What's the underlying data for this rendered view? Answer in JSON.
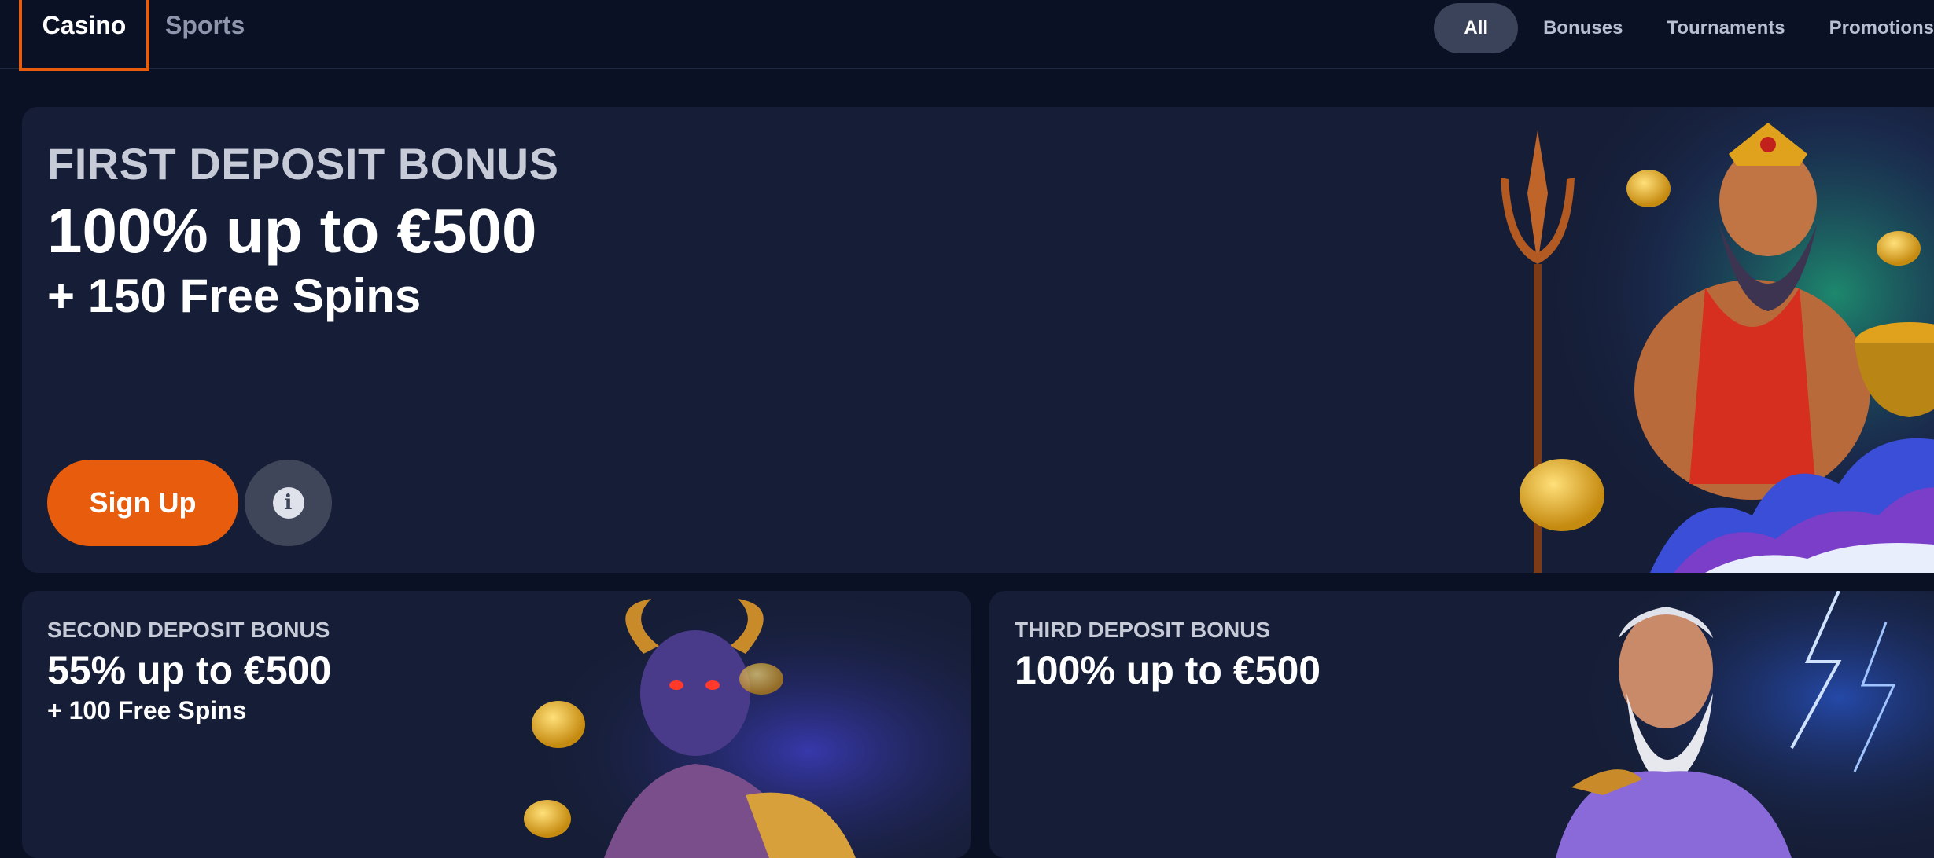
{
  "nav": {
    "sections": [
      "Casino",
      "Sports"
    ],
    "filters": [
      "All",
      "Bonuses",
      "Tournaments",
      "Promotions"
    ]
  },
  "hero": {
    "kicker": "FIRST DEPOSIT BONUS",
    "headline": "100% up to €500",
    "sub": "+ 150 Free Spins",
    "cta_label": "Sign Up",
    "info_glyph": "i"
  },
  "cards": [
    {
      "kicker": "SECOND DEPOSIT BONUS",
      "headline": "55% up to €500",
      "sub": "+ 100 Free Spins"
    },
    {
      "kicker": "THIRD DEPOSIT BONUS",
      "headline": "100% up to €500"
    }
  ],
  "colors": {
    "accent": "#e85d0d",
    "background": "#0b1124",
    "card": "#161e37"
  }
}
